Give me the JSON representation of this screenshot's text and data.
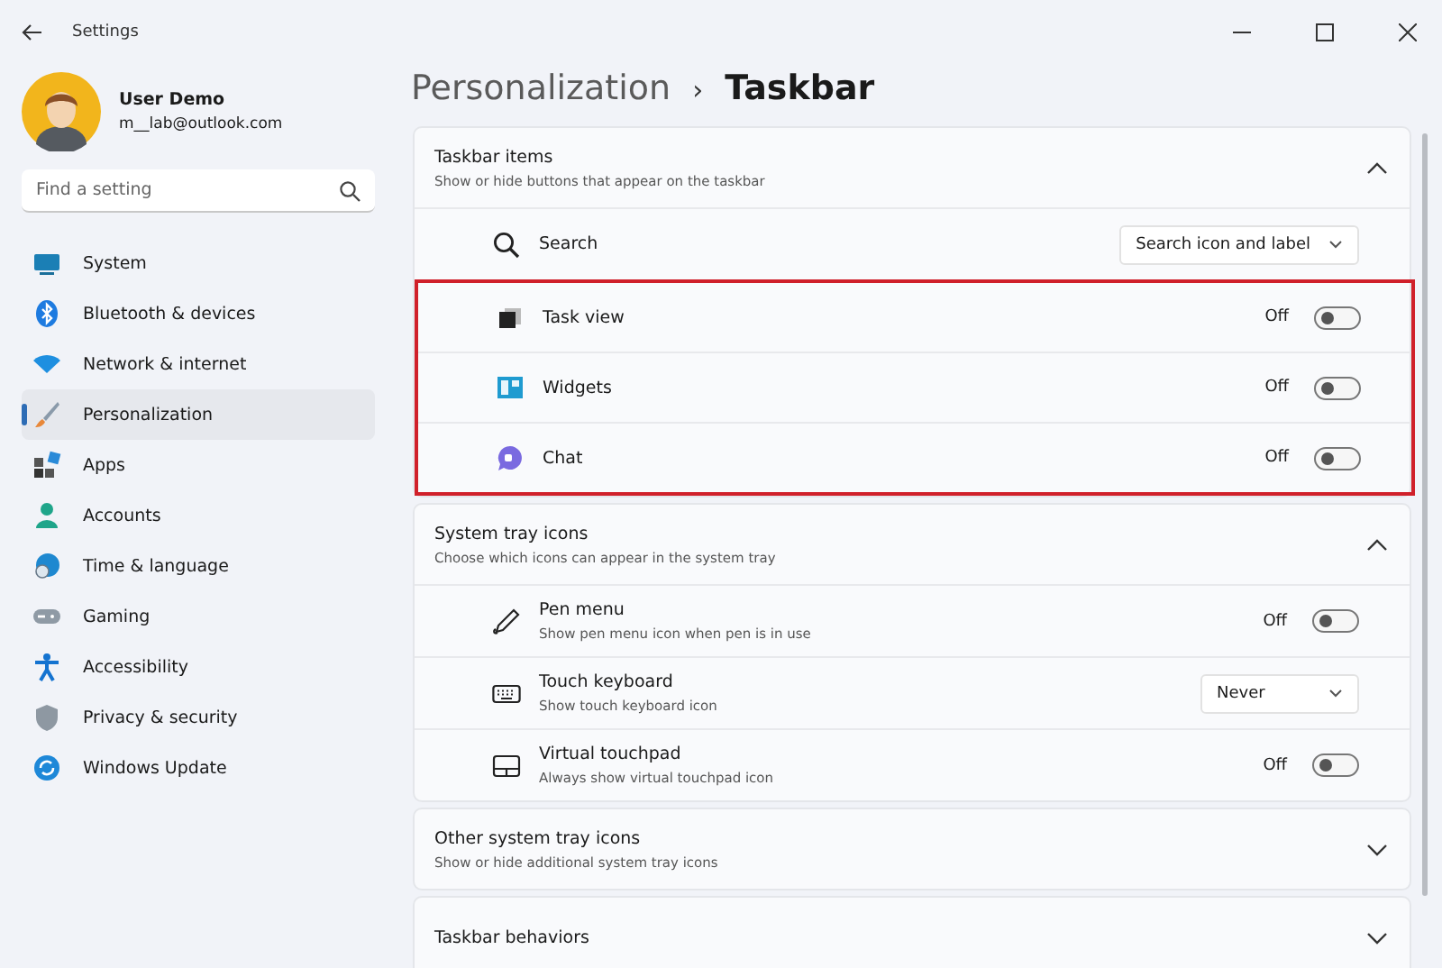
{
  "window": {
    "title": "Settings"
  },
  "user": {
    "name": "User Demo",
    "email": "m__lab@outlook.com"
  },
  "search": {
    "placeholder": "Find a setting"
  },
  "nav": [
    {
      "label": "System",
      "selected": false
    },
    {
      "label": "Bluetooth & devices",
      "selected": false
    },
    {
      "label": "Network & internet",
      "selected": false
    },
    {
      "label": "Personalization",
      "selected": true
    },
    {
      "label": "Apps",
      "selected": false
    },
    {
      "label": "Accounts",
      "selected": false
    },
    {
      "label": "Time & language",
      "selected": false
    },
    {
      "label": "Gaming",
      "selected": false
    },
    {
      "label": "Accessibility",
      "selected": false
    },
    {
      "label": "Privacy & security",
      "selected": false
    },
    {
      "label": "Windows Update",
      "selected": false
    }
  ],
  "breadcrumb": {
    "parent": "Personalization",
    "separator": "›",
    "current": "Taskbar"
  },
  "sections": [
    {
      "title": "Taskbar items",
      "subtitle": "Show or hide buttons that appear on the taskbar",
      "expanded": true,
      "items": [
        {
          "kind": "dropdown",
          "label": "Search",
          "value": "Search icon and label"
        },
        {
          "kind": "highlight",
          "items": [
            {
              "kind": "toggle",
              "label": "Task view",
              "state": "Off",
              "on": false
            },
            {
              "kind": "toggle",
              "label": "Widgets",
              "state": "Off",
              "on": false
            },
            {
              "kind": "toggle",
              "label": "Chat",
              "state": "Off",
              "on": false
            }
          ]
        }
      ]
    },
    {
      "title": "System tray icons",
      "subtitle": "Choose which icons can appear in the system tray",
      "expanded": true,
      "items": [
        {
          "kind": "toggle",
          "label": "Pen menu",
          "description": "Show pen menu icon when pen is in use",
          "state": "Off",
          "on": false
        },
        {
          "kind": "dropdown",
          "label": "Touch keyboard",
          "description": "Show touch keyboard icon",
          "value": "Never"
        },
        {
          "kind": "toggle",
          "label": "Virtual touchpad",
          "description": "Always show virtual touchpad icon",
          "state": "Off",
          "on": false
        }
      ]
    },
    {
      "title": "Other system tray icons",
      "subtitle": "Show or hide additional system tray icons",
      "expanded": false
    },
    {
      "title": "Taskbar behaviors",
      "expanded": false
    }
  ]
}
